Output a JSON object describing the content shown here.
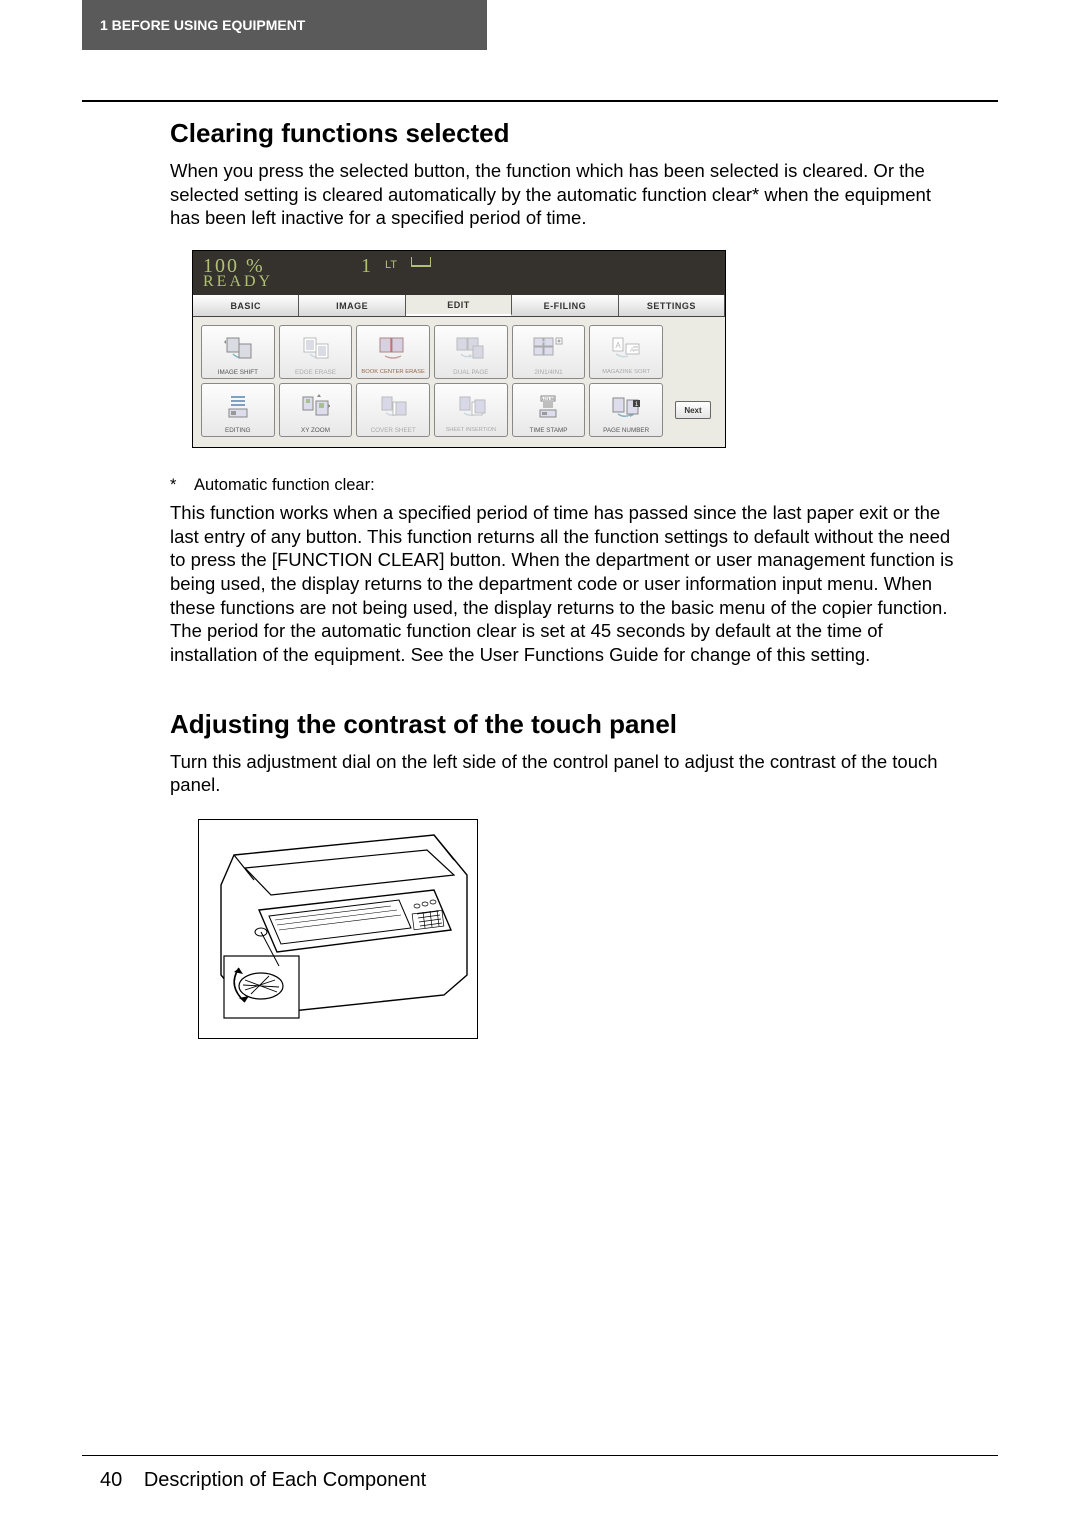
{
  "header": {
    "chapter": "1  BEFORE USING EQUIPMENT"
  },
  "section1": {
    "title": "Clearing functions selected",
    "intro": "When you press the selected button, the function which has been selected is cleared. Or the selected setting is cleared automatically by the automatic function clear* when the equipment has been left inactive for a specified period of time."
  },
  "lcd": {
    "zoom": "100  %",
    "status": "READY",
    "count": "1",
    "paper": "LT",
    "tabs": [
      "BASIC",
      "IMAGE",
      "EDIT",
      "E-FILING",
      "SETTINGS"
    ],
    "active_tab_index": 2,
    "buttons_row1": [
      {
        "label": "IMAGE SHIFT"
      },
      {
        "label": "EDGE ERASE",
        "muted": true
      },
      {
        "label": "BOOK CENTER ERASE",
        "selected": true
      },
      {
        "label": "DUAL  PAGE",
        "muted": true
      },
      {
        "label": "2IN1/4IN1",
        "muted": true
      },
      {
        "label": "MAGAZINE SORT",
        "muted": true
      }
    ],
    "buttons_row2": [
      {
        "label": "EDITING"
      },
      {
        "label": "XY ZOOM"
      },
      {
        "label": "COVER SHEET",
        "muted": true
      },
      {
        "label": "SHEET INSERTION",
        "muted": true
      },
      {
        "label": "TIME STAMP"
      },
      {
        "label": "PAGE NUMBER"
      }
    ],
    "next": "Next"
  },
  "footnote": {
    "star": "*",
    "label": "Automatic function clear:",
    "text": "This function works when a specified period of time has passed since the last paper exit or the last entry of any button. This function returns all the function settings to default without the need to press the [FUNCTION CLEAR] button. When the department or user management function is being used, the display returns to the department code or user information input menu. When these functions are not being used, the display returns to the basic menu of the copier function. The period for the automatic function clear is set at 45 seconds by default at the time of installation of the equipment. See the User Functions Guide for change of this setting."
  },
  "section2": {
    "title": "Adjusting the contrast of the touch panel",
    "intro": "Turn this adjustment dial on the left side of the control panel to adjust the contrast of the touch panel."
  },
  "footer": {
    "page": "40",
    "title": "Description of Each Component"
  }
}
